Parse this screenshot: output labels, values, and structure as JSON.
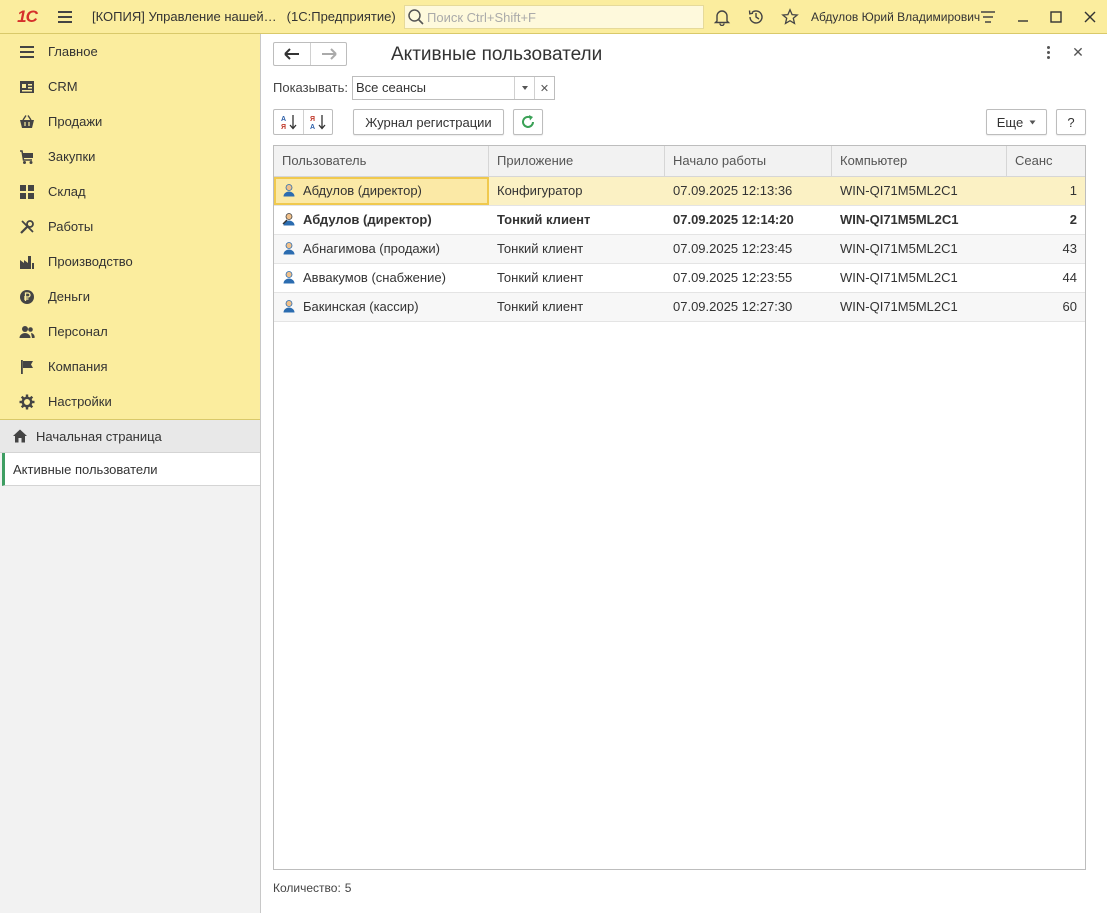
{
  "titlebar": {
    "logo": "1С",
    "title": "[КОПИЯ] Управление нашей…",
    "platform": "(1С:Предприятие)",
    "search_placeholder": "Поиск Ctrl+Shift+F",
    "user": "Абдулов Юрий Владимирович"
  },
  "sidebar": {
    "sections": [
      {
        "label": "Главное",
        "icon": "menu-lines-icon"
      },
      {
        "label": "CRM",
        "icon": "contact-card-icon"
      },
      {
        "label": "Продажи",
        "icon": "basket-icon"
      },
      {
        "label": "Закупки",
        "icon": "cart-icon"
      },
      {
        "label": "Склад",
        "icon": "grid-icon"
      },
      {
        "label": "Работы",
        "icon": "tools-icon"
      },
      {
        "label": "Производство",
        "icon": "factory-icon"
      },
      {
        "label": "Деньги",
        "icon": "ruble-icon"
      },
      {
        "label": "Персонал",
        "icon": "people-icon"
      },
      {
        "label": "Компания",
        "icon": "flag-icon"
      },
      {
        "label": "Настройки",
        "icon": "gear-icon"
      }
    ],
    "home": "Начальная страница",
    "active": "Активные пользователи"
  },
  "form": {
    "title": "Активные пользователи",
    "show_label": "Показывать:",
    "show_value": "Все сеансы",
    "journal_button": "Журнал регистрации",
    "more_button": "Еще",
    "help_button": "?",
    "count_label": "Количество:",
    "count_value": "5"
  },
  "table": {
    "columns": [
      "Пользователь",
      "Приложение",
      "Начало работы",
      "Компьютер",
      "Сеанс"
    ],
    "rows": [
      {
        "user": "Абдулов (директор)",
        "app": "Конфигуратор",
        "start": "07.09.2025 12:13:36",
        "computer": "WIN-QI71M5ML2C1",
        "session": "1"
      },
      {
        "user": "Абдулов (директор)",
        "app": "Тонкий клиент",
        "start": "07.09.2025 12:14:20",
        "computer": "WIN-QI71M5ML2C1",
        "session": "2"
      },
      {
        "user": "Абнагимова (продажи)",
        "app": "Тонкий клиент",
        "start": "07.09.2025 12:23:45",
        "computer": "WIN-QI71M5ML2C1",
        "session": "43"
      },
      {
        "user": "Аввакумов (снабжение)",
        "app": "Тонкий клиент",
        "start": "07.09.2025 12:23:55",
        "computer": "WIN-QI71M5ML2C1",
        "session": "44"
      },
      {
        "user": "Бакинская (кассир)",
        "app": "Тонкий клиент",
        "start": "07.09.2025 12:27:30",
        "computer": "WIN-QI71M5ML2C1",
        "session": "60"
      }
    ]
  }
}
